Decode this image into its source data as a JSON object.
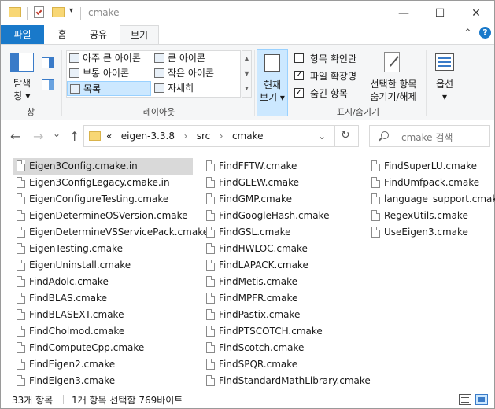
{
  "window": {
    "title": "cmake",
    "minimize_glyph": "—",
    "maximize_glyph": "☐",
    "close_glyph": "✕"
  },
  "ribbon": {
    "tabs": [
      {
        "label": "파일"
      },
      {
        "label": "홈"
      },
      {
        "label": "공유"
      },
      {
        "label": "보기"
      }
    ],
    "collapse_glyph": "⌃",
    "help_glyph": "?",
    "pane": {
      "nav_label_1": "탐색",
      "nav_label_2": "창 ▾",
      "group": "창"
    },
    "layout": {
      "items": [
        {
          "label": "아주 큰 아이콘"
        },
        {
          "label": "큰 아이콘"
        },
        {
          "label": "보통 아이콘"
        },
        {
          "label": "작은 아이콘"
        },
        {
          "label": "목록"
        },
        {
          "label": "자세히"
        }
      ],
      "group": "레이아웃"
    },
    "current_view": {
      "label_1": "현재",
      "label_2": "보기 ▾"
    },
    "show_hide": {
      "checkboxes": [
        {
          "label": "항목 확인란",
          "checked": false
        },
        {
          "label": "파일 확장명",
          "checked": true
        },
        {
          "label": "숨긴 항목",
          "checked": true
        }
      ],
      "hide_selected_1": "선택한 항목",
      "hide_selected_2": "숨기기/해제",
      "group": "표시/숨기기"
    },
    "options": {
      "label_1": "옵션",
      "label_2": "▾"
    }
  },
  "address": {
    "back_glyph": "←",
    "forward_glyph": "→",
    "recent_glyph": "⌄",
    "up_glyph": "↑",
    "overflow": "«",
    "crumbs": [
      "eigen-3.3.8",
      "src",
      "cmake"
    ],
    "crumb_sep": "›",
    "dropdown_glyph": "⌄",
    "refresh_glyph": "↻",
    "search_placeholder": "cmake 검색"
  },
  "files": {
    "columns": [
      [
        "Eigen3Config.cmake.in",
        "Eigen3ConfigLegacy.cmake.in",
        "EigenConfigureTesting.cmake",
        "EigenDetermineOSVersion.cmake",
        "EigenDetermineVSServicePack.cmake",
        "EigenTesting.cmake",
        "EigenUninstall.cmake",
        "FindAdolc.cmake",
        "FindBLAS.cmake",
        "FindBLASEXT.cmake",
        "FindCholmod.cmake",
        "FindComputeCpp.cmake",
        "FindEigen2.cmake",
        "FindEigen3.cmake"
      ],
      [
        "FindFFTW.cmake",
        "FindGLEW.cmake",
        "FindGMP.cmake",
        "FindGoogleHash.cmake",
        "FindGSL.cmake",
        "FindHWLOC.cmake",
        "FindLAPACK.cmake",
        "FindMetis.cmake",
        "FindMPFR.cmake",
        "FindPastix.cmake",
        "FindPTSCOTCH.cmake",
        "FindScotch.cmake",
        "FindSPQR.cmake",
        "FindStandardMathLibrary.cmake"
      ],
      [
        "FindSuperLU.cmake",
        "FindUmfpack.cmake",
        "language_support.cmake",
        "RegexUtils.cmake",
        "UseEigen3.cmake"
      ]
    ],
    "selected": "Eigen3Config.cmake.in"
  },
  "status": {
    "count": "33개 항목",
    "selection": "1개 항목 선택함 769바이트"
  },
  "colors": {
    "accent": "#1979ca",
    "selection": "#cce8ff",
    "folder": "#f8d775"
  }
}
